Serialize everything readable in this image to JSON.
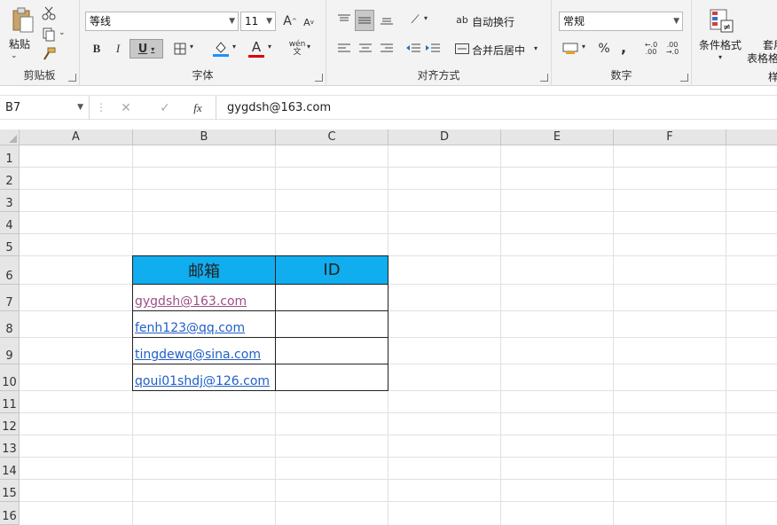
{
  "ribbon": {
    "clipboard": {
      "paste_label": "粘贴",
      "group_label": "剪贴板"
    },
    "font": {
      "name": "等线",
      "size": "11",
      "bold": "B",
      "italic": "I",
      "underline": "U",
      "grow": "A",
      "shrink": "A",
      "font_color": "A",
      "phonetic": "wén",
      "group_label": "字体"
    },
    "alignment": {
      "wrap_text": "自动换行",
      "merge_center": "合并后居中",
      "group_label": "对齐方式"
    },
    "number": {
      "format": "常规",
      "percent": "%",
      "comma": ",",
      "group_label": "数字"
    },
    "styles": {
      "conditional_formatting": "条件格式",
      "format_table_1": "套用",
      "format_table_2": "表格格式",
      "group_label_partial": "样"
    },
    "colors": {
      "fill_bar": "#1e90ff",
      "font_bar": "#e00000"
    }
  },
  "formula_bar": {
    "name_box": "B7",
    "fx": "fx",
    "content": "gygdsh@163.com"
  },
  "columns": [
    "A",
    "B",
    "C",
    "D",
    "E",
    "F"
  ],
  "rows": [
    "1",
    "2",
    "3",
    "4",
    "5",
    "6",
    "7",
    "8",
    "9",
    "10",
    "11",
    "12",
    "13",
    "14",
    "15",
    "16"
  ],
  "table": {
    "header_color": "#10adef",
    "headers": [
      "邮箱",
      "ID"
    ],
    "emails": [
      "gygdsh@163.com",
      "fenh123@qq.com",
      "tingdewq@sina.com",
      "qoui01shdj@126.com"
    ]
  }
}
